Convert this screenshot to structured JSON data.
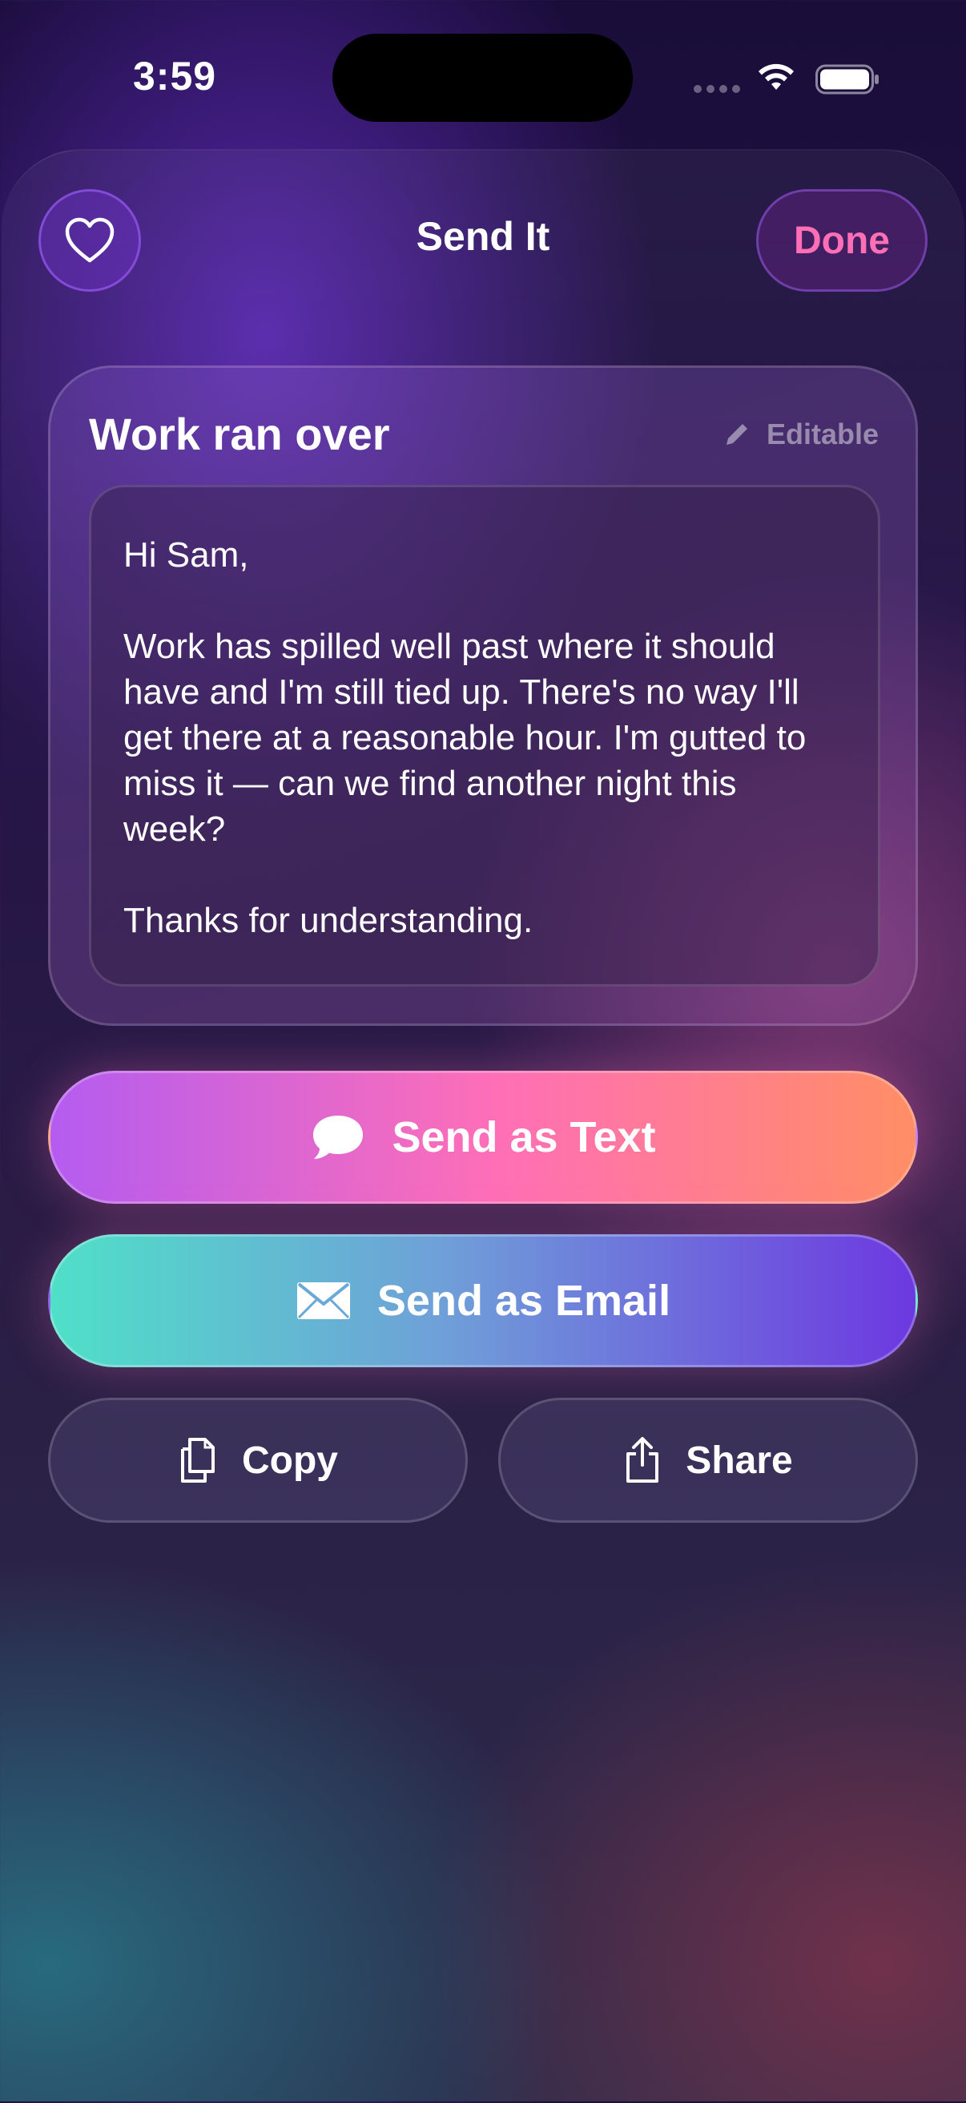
{
  "status_bar": {
    "time": "3:59",
    "icons": [
      "signal-dots-icon",
      "wifi-icon",
      "battery-icon"
    ]
  },
  "header": {
    "favorite_icon": "heart-icon",
    "title": "Send It",
    "done_label": "Done"
  },
  "message": {
    "title": "Work ran over",
    "editable_label": "Editable",
    "editable_icon": "pencil-icon",
    "body": "Hi Sam,\n\nWork has spilled well past where it should have and I'm still tied up. There's no way I'll get there at a reasonable hour. I'm gutted to miss it — can we find another night this week?\n\nThanks for understanding."
  },
  "actions": {
    "send_text_label": "Send as Text",
    "send_text_icon": "message-bubble-icon",
    "send_email_label": "Send as Email",
    "send_email_icon": "envelope-icon",
    "copy_label": "Copy",
    "copy_icon": "copy-icon",
    "share_label": "Share",
    "share_icon": "share-icon"
  },
  "colors": {
    "done_accent": "#ff6fb6",
    "send_text_gradient": [
      "#b45cf0",
      "#ff6fb6",
      "#ff8e65"
    ],
    "send_email_gradient": [
      "#4fe0c8",
      "#6fa0d8",
      "#6d38e0"
    ]
  }
}
